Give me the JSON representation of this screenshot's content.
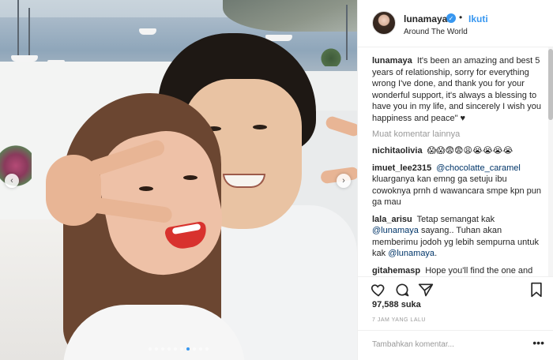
{
  "post": {
    "username": "lunamaya",
    "separator": "•",
    "follow_label": "Ikuti",
    "location": "Around The World",
    "caption_author": "lunamaya",
    "caption_text": "It's been an amazing and best 5 years of relationship, sorry for everything wrong I've done, and thank you for your wonderful support, it's always a blessing to have you in my life, and sincerely I wish you happiness and peace\" ♥",
    "load_more_label": "Muat komentar lainnya",
    "likes": "97,588 suka",
    "time": "7 JAM YANG LALU",
    "add_comment_placeholder": "Tambahkan komentar...",
    "more_options": "•••"
  },
  "comments": [
    {
      "author": "nichitaolivia",
      "text": "😱😱😨😨😩😭😭😭😭"
    },
    {
      "author": "imuet_lee2315",
      "mention": "@chocolatte_caramel",
      "text": "kluarganya kan emng ga setuju ibu cowoknya prnh d wawancara smpe kpn pun ga mau"
    },
    {
      "author": "lala_arisu",
      "text": "Tetap semangat kak",
      "mention": "@lunamaya",
      "text2": "sayang.. Tuhan akan memberimu jodoh yg lebih sempurna untuk kak",
      "mention2": "@lunamaya",
      "text3": "."
    },
    {
      "author": "gitahemasp",
      "text": "Hope you'll find the one and only and the last"
    }
  ],
  "carousel": {
    "total": 10,
    "active": 6,
    "prev_icon": "‹",
    "next_icon": "›"
  },
  "colors": {
    "link": "#3897f0",
    "mention": "#003569",
    "text": "#262626",
    "muted": "#999999"
  },
  "icons": [
    "heart-icon",
    "comment-icon",
    "share-icon",
    "bookmark-icon",
    "verified-badge-icon",
    "more-options-icon"
  ]
}
